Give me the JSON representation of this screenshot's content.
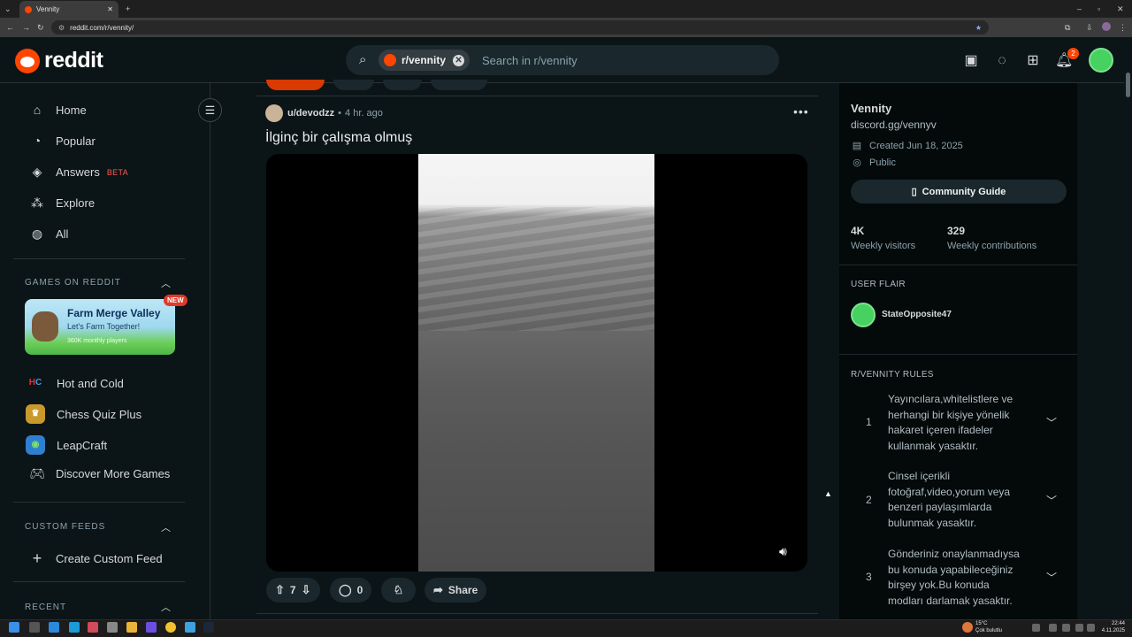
{
  "browser": {
    "tab_title": "Vennity",
    "url": "reddit.com/r/vennity/"
  },
  "header": {
    "logo_text": "reddit",
    "search_chip": "r/vennity",
    "search_placeholder": "Search in r/vennity",
    "notification_count": "2"
  },
  "sidebar": {
    "nav": [
      {
        "label": "Home",
        "icon": "home-icon"
      },
      {
        "label": "Popular",
        "icon": "popular-icon"
      },
      {
        "label": "Answers",
        "icon": "answers-icon",
        "badge": "BETA"
      },
      {
        "label": "Explore",
        "icon": "explore-icon"
      },
      {
        "label": "All",
        "icon": "all-icon"
      }
    ],
    "games_title": "GAMES ON REDDIT",
    "featured_game": {
      "title": "Farm Merge Valley",
      "subtitle": "Let's Farm Together!",
      "players": "360K monthly players",
      "badge": "NEW"
    },
    "games": [
      {
        "label": "Hot and Cold"
      },
      {
        "label": "Chess Quiz Plus"
      },
      {
        "label": "LeapCraft"
      },
      {
        "label": "Discover More Games"
      }
    ],
    "custom_feeds_title": "CUSTOM FEEDS",
    "create_feed": "Create Custom Feed",
    "recent_title": "RECENT"
  },
  "post": {
    "author": "u/devodzz",
    "separator": "•",
    "time": "4 hr. ago",
    "title": "İlginç bir çalışma olmuş",
    "votes": "7",
    "comments": "0",
    "share": "Share"
  },
  "community": {
    "name": "Vennity",
    "description": "discord.gg/vennyv",
    "created": "Created Jun 18, 2025",
    "visibility": "Public",
    "guide_button": "Community Guide",
    "visitors_value": "4K",
    "visitors_label": "Weekly visitors",
    "contrib_value": "329",
    "contrib_label": "Weekly contributions",
    "flair_title": "USER FLAIR",
    "flair_user": "StateOpposite47",
    "rules_title": "R/VENNITY RULES",
    "rules": [
      {
        "num": "1",
        "text": "Yayıncılara,whitelistlere ve herhangi bir kişiye yönelik hakaret içeren ifadeler kullanmak yasaktır."
      },
      {
        "num": "2",
        "text": "Cinsel içerikli fotoğraf,video,yorum veya benzeri paylaşımlarda bulunmak yasaktır."
      },
      {
        "num": "3",
        "text": "Gönderiniz onaylanmadıysa bu konuda yapabileceğiniz birşey yok.Bu konuda modları darlamak yasaktır."
      }
    ]
  },
  "taskbar": {
    "weather_temp": "15°C",
    "weather_desc": "Çok bulutlu",
    "time": "22:44",
    "date": "4.11.2025"
  }
}
